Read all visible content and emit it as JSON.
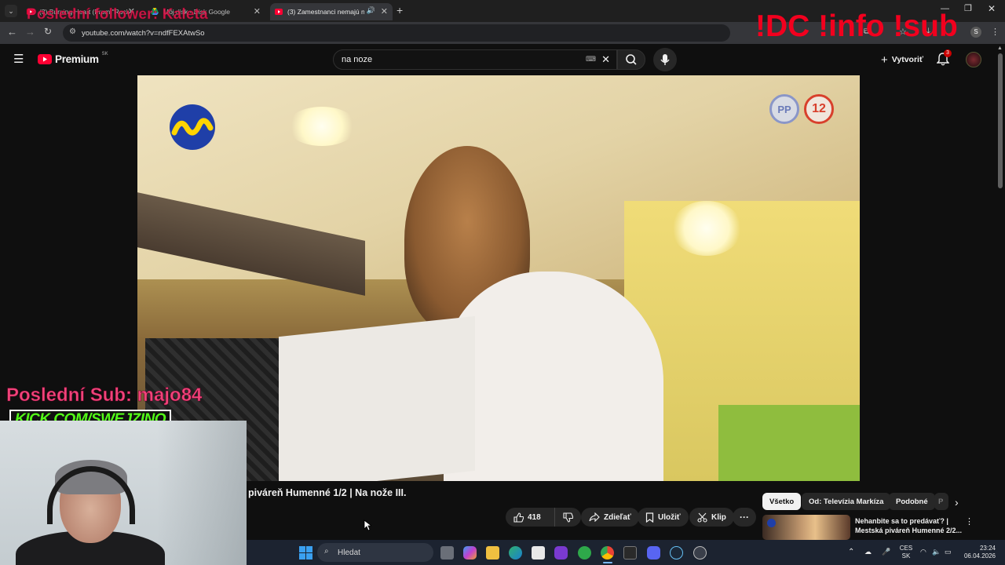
{
  "browser": {
    "tabs": [
      {
        "label": "(3) Burning Heart (From \"Rock",
        "favicon": "youtube-icon",
        "active": false
      },
      {
        "label": "Môj disk - Disk Google",
        "favicon": "google-drive-icon",
        "active": false
      },
      {
        "label": "(3) Zamestnanci nemajú ná",
        "favicon": "youtube-icon",
        "active": true
      }
    ],
    "url": "youtube.com/watch?v=ndfFEXAtwSo"
  },
  "youtube": {
    "brand": "Premium",
    "region": "SK",
    "search_value": "na noze",
    "create_label": "Vytvoriť",
    "notification_count": "3"
  },
  "video": {
    "rating_badges": [
      "PP",
      "12"
    ],
    "title": "piváreň Humenné 1/2 | Na nože III."
  },
  "actions": {
    "likes": "418",
    "share": "Zdieľať",
    "save": "Uložiť",
    "clip": "Klip"
  },
  "chips": [
    "Všetko",
    "Od: Televízia Markíza",
    "Podobné",
    "P"
  ],
  "recommended": [
    {
      "title_line1": "Nehanbite sa to predávať? |",
      "title_line2": "Mestská piváreň Humenné 2/2..."
    }
  ],
  "overlays": {
    "follower": "Poslední follower: Kaleta",
    "commands": "!DC !info !sub",
    "last_sub": "Poslední Sub: majo84",
    "kick": "KICK.COM/SWEJZINO"
  },
  "taskbar": {
    "search_placeholder": "Hledat",
    "lang_line1": "CES",
    "lang_line2": "SK",
    "time": "23:24",
    "date": "06.04.2026"
  },
  "colors": {
    "youtube_red": "#ff0033",
    "overlay_red": "#f2001e",
    "overlay_pink": "#f0437a",
    "kick_green": "#53fc18",
    "markiza_blue": "#1f3fa8",
    "markiza_yellow": "#ffd400"
  }
}
